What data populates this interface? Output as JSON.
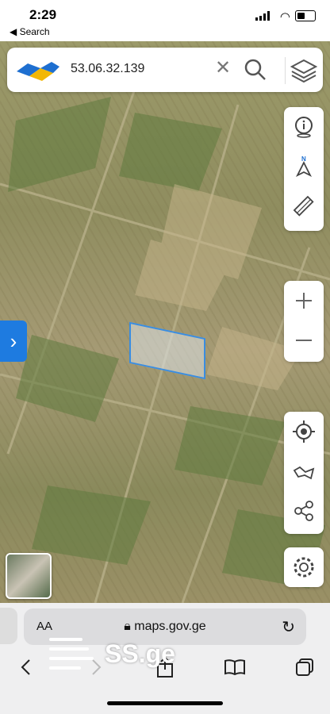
{
  "status_bar": {
    "time": "2:29",
    "back_label": "◀ Search"
  },
  "search": {
    "value": "53.06.32.139"
  },
  "url_bar": {
    "text_size_label": "AA",
    "url": "maps.gov.ge"
  },
  "watermark": {
    "text": "SS.ge"
  },
  "colors": {
    "accent": "#1e7be0",
    "parcel_border": "#3a8de0"
  },
  "icons": {
    "side_panel": [
      "info-icon",
      "compass-icon",
      "measure-icon"
    ],
    "zoom": [
      "zoom-in-icon",
      "zoom-out-icon"
    ],
    "tools": [
      "locate-icon",
      "route-icon",
      "share-icon"
    ],
    "settings": "gear-icon"
  }
}
